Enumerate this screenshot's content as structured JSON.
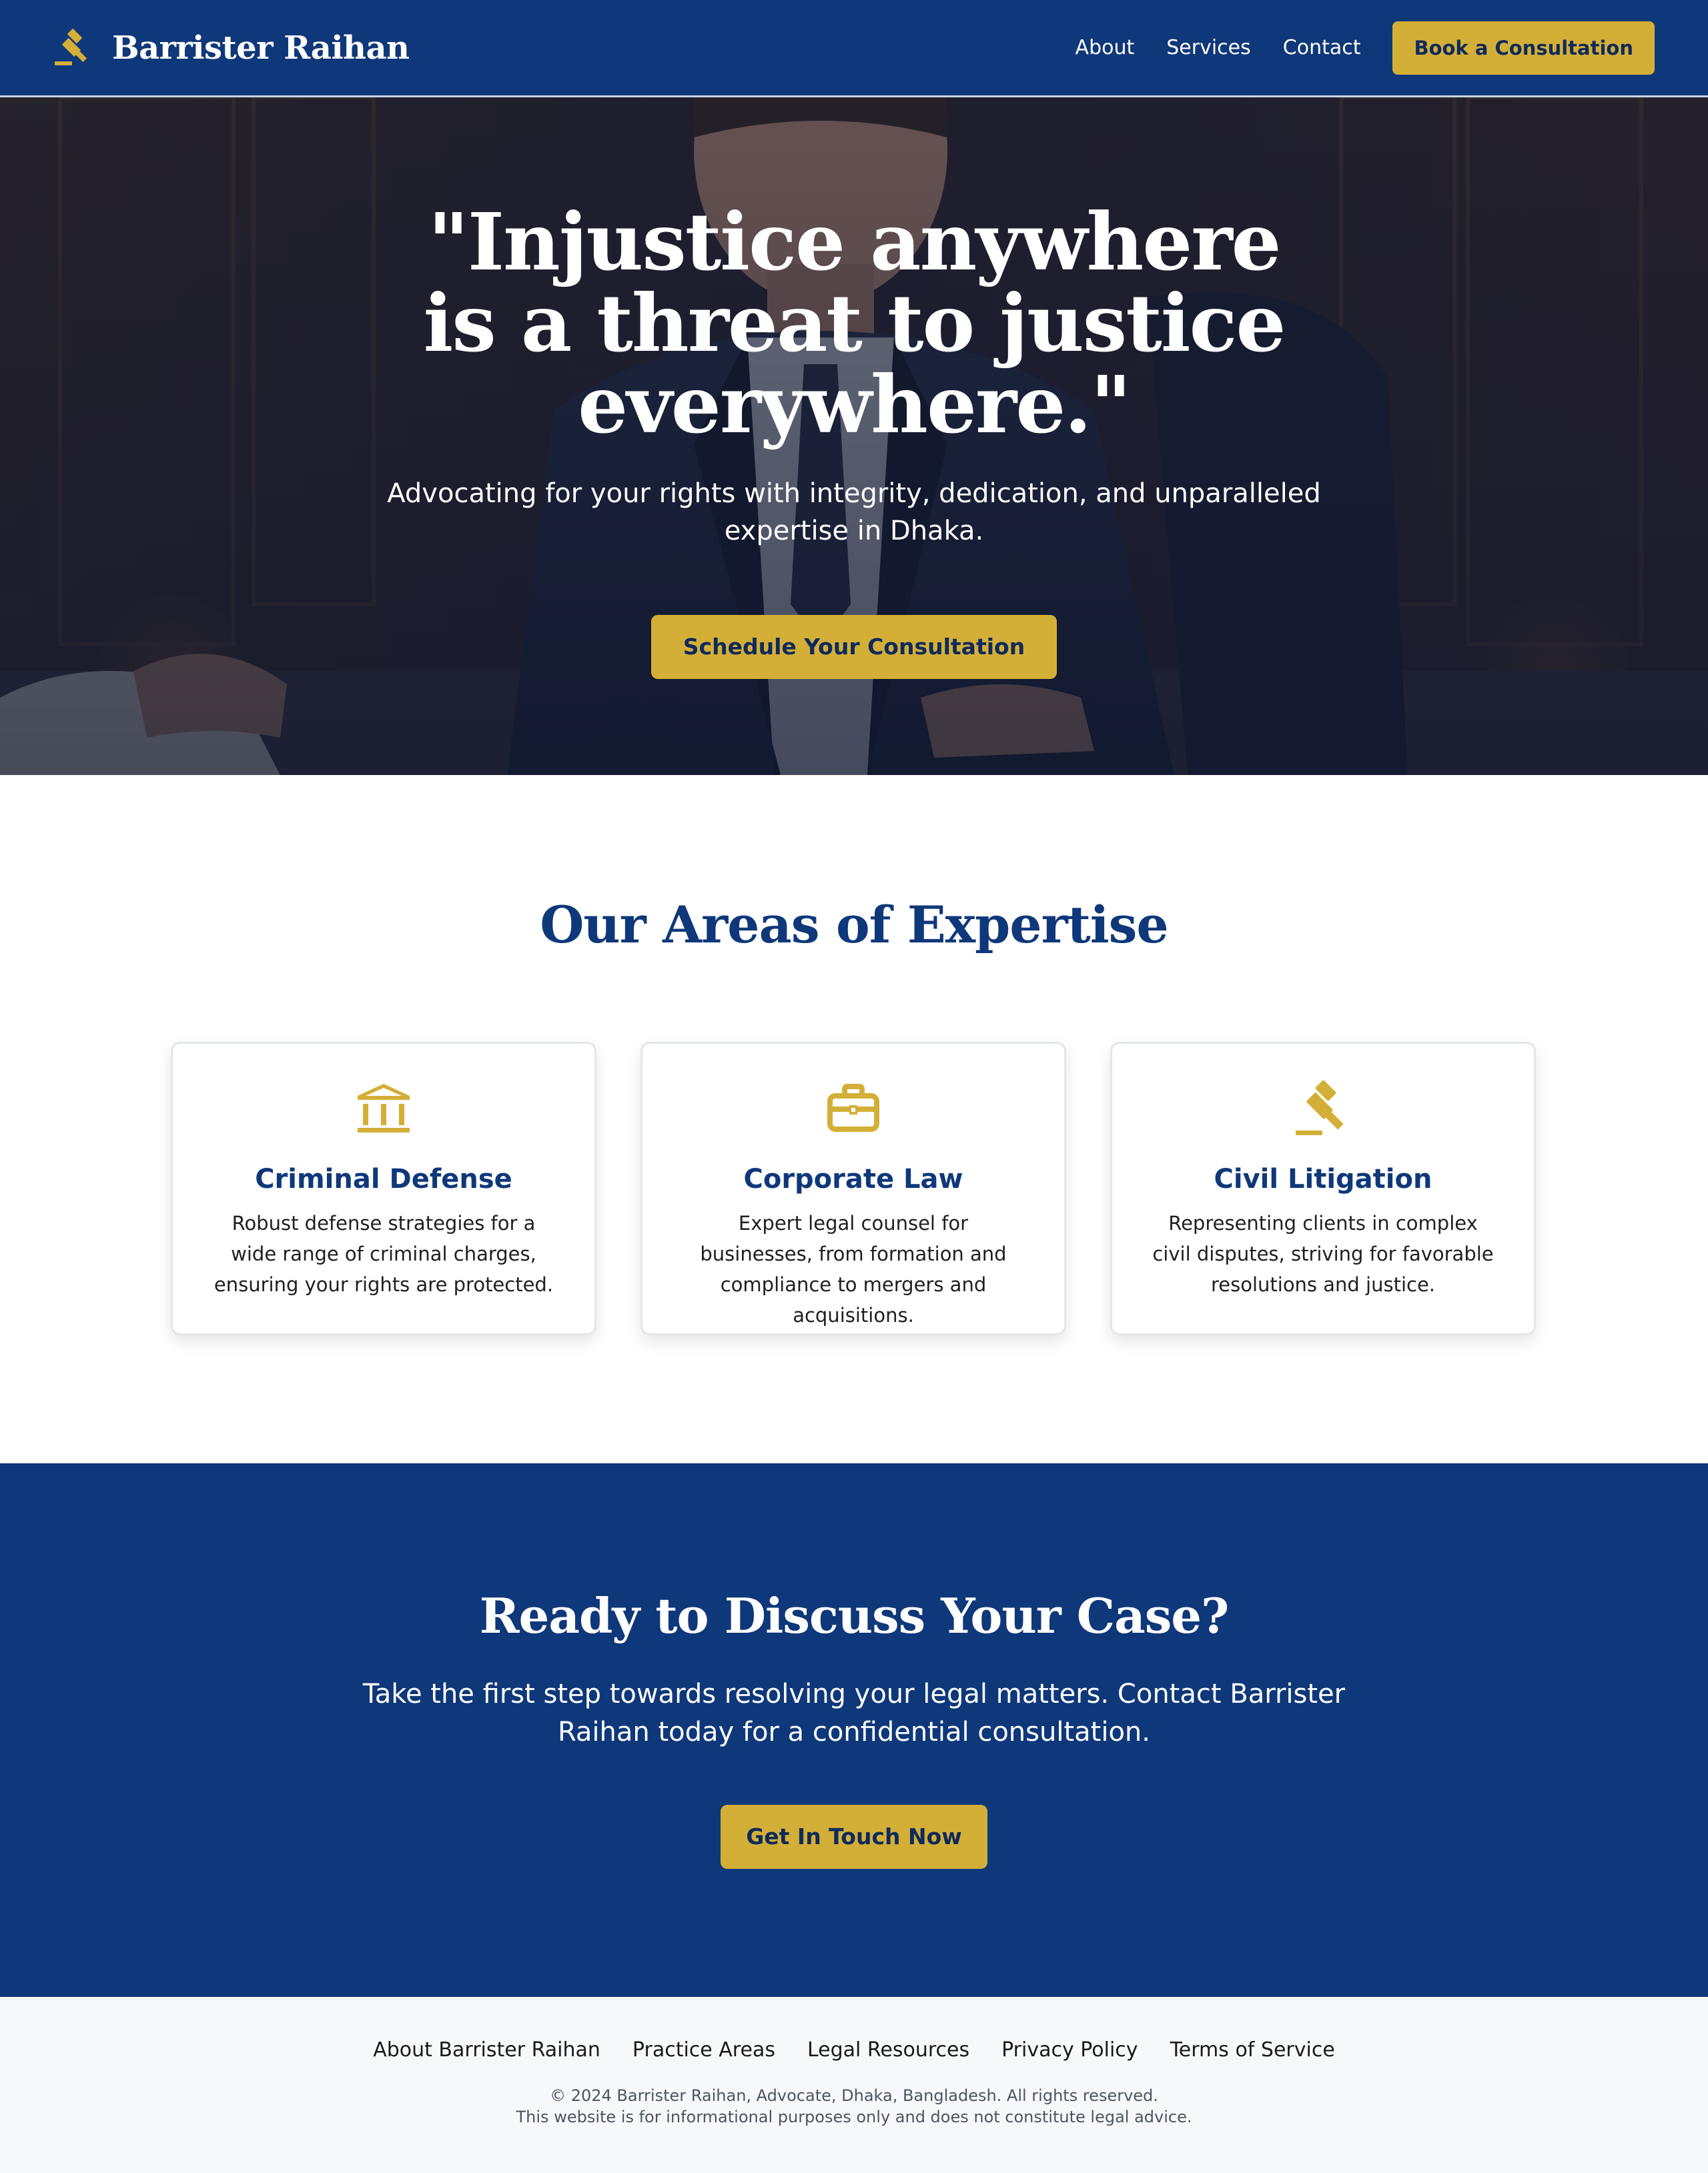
{
  "header": {
    "brand_name": "Barrister Raihan",
    "brand_icon": "gavel-icon",
    "nav": [
      {
        "label": "About"
      },
      {
        "label": "Services"
      },
      {
        "label": "Contact"
      }
    ],
    "cta_label": "Book a Consultation"
  },
  "hero": {
    "quote": "\"Injustice anywhere is a threat to justice everywhere.\"",
    "subtitle": "Advocating for your rights with integrity, dedication, and unparalleled expertise in Dhaka.",
    "button_label": "Schedule Your Consultation"
  },
  "expertise": {
    "title": "Our Areas of Expertise",
    "cards": [
      {
        "icon": "courthouse-icon",
        "title": "Criminal Defense",
        "description": "Robust defense strategies for a wide range of criminal charges, ensuring your rights are protected."
      },
      {
        "icon": "briefcase-icon",
        "title": "Corporate Law",
        "description": "Expert legal counsel for businesses, from formation and compliance to mergers and acquisitions."
      },
      {
        "icon": "gavel-icon",
        "title": "Civil Litigation",
        "description": "Representing clients in complex civil disputes, striving for favorable resolutions and justice."
      }
    ]
  },
  "cta": {
    "title": "Ready to Discuss Your Case?",
    "subtitle": "Take the first step towards resolving your legal matters. Contact Barrister Raihan today for a confidential consultation.",
    "button_label": "Get In Touch Now"
  },
  "footer": {
    "links": [
      {
        "label": "About Barrister Raihan"
      },
      {
        "label": "Practice Areas"
      },
      {
        "label": "Legal Resources"
      },
      {
        "label": "Privacy Policy"
      },
      {
        "label": "Terms of Service"
      }
    ],
    "copyright": "© 2024 Barrister Raihan, Advocate, Dhaka, Bangladesh. All rights reserved.",
    "disclaimer": "This website is for informational purposes only and does not constitute legal advice."
  },
  "colors": {
    "primary_navy": "#0f387a",
    "accent_gold": "#d4af37",
    "footer_bg": "#f7f8fa"
  }
}
